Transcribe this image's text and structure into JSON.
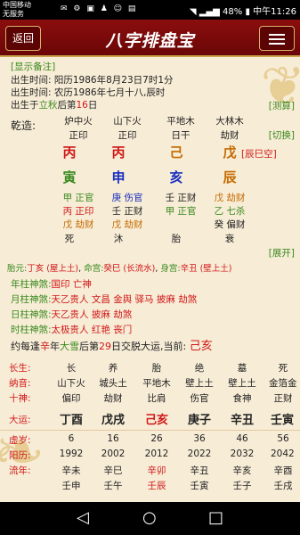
{
  "status_bar": {
    "carrier_line1": "中国移动",
    "carrier_line2": "无服务",
    "battery": "48%",
    "time": "中午11:26"
  },
  "app_bar": {
    "back_label": "返回",
    "title": "八字排盘宝"
  },
  "info": {
    "toggle_remark": "[显示备注]",
    "solar_birth": "出生时间: 阳历1986年8月23日7时1分",
    "lunar_birth": "出生时间: 农历1986年七月十八,辰时",
    "born_after_prefix": "出生于",
    "born_after_term": "立秋",
    "born_after_suffix": "后第",
    "born_after_day": "16",
    "born_after_end": "日",
    "calc_link": "[测算]"
  },
  "qianzao": {
    "label": "乾造:",
    "nayin": [
      "炉中火",
      "山下火",
      "平地木",
      "大林木"
    ],
    "shishen_top": [
      "正印",
      "正印",
      "日干",
      "劫财"
    ],
    "gan": [
      "丙",
      "丙",
      "己",
      "戊"
    ],
    "gan_extra": "[辰巳空]",
    "switch_link": "[切换]",
    "zhi": [
      "寅",
      "申",
      "亥",
      "辰"
    ],
    "canggan": [
      [
        "甲 正官",
        "庚 伤官",
        "壬 正财",
        "戊 劫财"
      ],
      [
        "丙 正印",
        "壬 正财",
        "甲 正官",
        "乙 七杀"
      ],
      [
        "戊 劫财",
        "戊 劫财",
        "",
        "癸 偏财"
      ]
    ],
    "changsheng": [
      "死",
      "沐",
      "胎",
      "衰"
    ],
    "expand_link": "[展开]"
  },
  "palace": {
    "taiyuan_label": "胎元:",
    "taiyuan_value": "丁亥 (屋上土)",
    "minggong_label": "命宫:",
    "minggong_value": "癸巳 (长流水)",
    "shengong_label": "身宫:",
    "shengong_value": "辛丑 (壁上土)"
  },
  "shensha": [
    {
      "label": "年柱神煞:",
      "value": "国印 亡神"
    },
    {
      "label": "月柱神煞:",
      "value": "天乙贵人 文昌 金舆 驿马 披麻 劫煞"
    },
    {
      "label": "日柱神煞:",
      "value": "天乙贵人 披麻 劫煞"
    },
    {
      "label": "时柱神煞:",
      "value": "太极贵人 红艳 丧门"
    }
  ],
  "dayun_intro": {
    "p1": "约每逢",
    "year_gan": "辛",
    "p2": "年",
    "term": "大雪",
    "p3": "后第",
    "day": "29",
    "p4": "日交脱大运,当前:",
    "current": "己亥"
  },
  "dayun_table": {
    "changsheng_label": "长生:",
    "changsheng": [
      "长",
      "养",
      "胎",
      "绝",
      "墓",
      "死"
    ],
    "nayin_label": "纳音:",
    "nayin": [
      "山下火",
      "城头土",
      "平地木",
      "壁上土",
      "壁上土",
      "金箔金"
    ],
    "shishen_label": "十神:",
    "shishen": [
      "偏印",
      "劫财",
      "比肩",
      "伤官",
      "食神",
      "正财"
    ],
    "dayun_label": "大运:",
    "dayun": [
      "丁酉",
      "戊戌",
      "己亥",
      "庚子",
      "辛丑",
      "壬寅"
    ],
    "xusui_label": "虚岁:",
    "xusui": [
      "6",
      "16",
      "26",
      "36",
      "46",
      "56"
    ],
    "yangli_label": "阳历:",
    "yangli": [
      "1992",
      "2002",
      "2012",
      "2022",
      "2032",
      "2042"
    ],
    "liunian_label": "流年:",
    "liunian_row1": [
      "辛未",
      "辛巳",
      "辛卯",
      "辛丑",
      "辛亥",
      "辛酉"
    ],
    "liunian_row2": [
      "壬申",
      "壬午",
      "壬辰",
      "壬寅",
      "壬子",
      "壬戌"
    ]
  }
}
